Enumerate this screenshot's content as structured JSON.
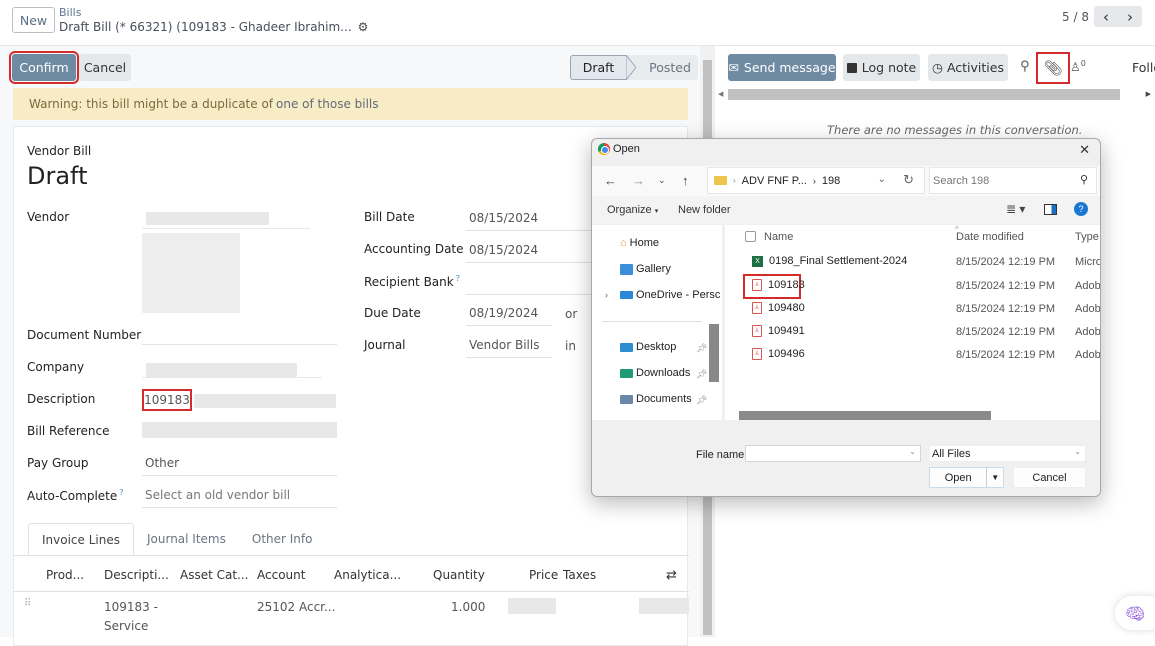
{
  "header": {
    "new_label": "New",
    "breadcrumb_parent": "Bills",
    "breadcrumb_current": "Draft Bill (* 66321) (109183 - Ghadeer Ibrahim...",
    "pager": "5 / 8",
    "prev_icon": "chevron-left",
    "next_icon": "chevron-right"
  },
  "actions": {
    "confirm_label": "Confirm",
    "cancel_label": "Cancel",
    "status_steps": [
      "Draft",
      "Posted"
    ],
    "status_current": "Draft"
  },
  "warning": {
    "text": "Warning: this bill might be a duplicate of",
    "link": "one of those bills"
  },
  "form": {
    "doc_type": "Vendor Bill",
    "title": "Draft",
    "left_labels": {
      "vendor": "Vendor",
      "document_number": "Document Number",
      "company": "Company",
      "description": "Description",
      "bill_reference": "Bill Reference",
      "pay_group": "Pay Group",
      "auto_complete": "Auto-Complete"
    },
    "description_value": "109183",
    "pay_group_value": "Other",
    "auto_complete_placeholder": "Select an old vendor bill",
    "right_labels": {
      "bill_date": "Bill Date",
      "accounting_date": "Accounting Date",
      "recipient_bank": "Recipient Bank",
      "due_date": "Due Date",
      "journal": "Journal"
    },
    "bill_date": "08/15/2024",
    "accounting_date": "08/15/2024",
    "due_date": "08/19/2024",
    "due_suffix": "or",
    "journal": "Vendor Bills",
    "journal_suffix": "in",
    "help_mark": "?"
  },
  "tabs": [
    "Invoice Lines",
    "Journal Items",
    "Other Info"
  ],
  "lines_table": {
    "columns": [
      "Prod...",
      "Descripti...",
      "Asset Cat...",
      "Account",
      "Analytica...",
      "Quantity",
      "Price",
      "Taxes"
    ],
    "rows": [
      {
        "description": [
          "109183 -",
          "Service"
        ],
        "account": "25102 Accr...",
        "quantity": "1.000"
      }
    ]
  },
  "chatter": {
    "send_message": "Send message",
    "log_note": "Log note",
    "activities": "Activities",
    "followers_count": "0",
    "follow_label": "Follo",
    "empty_text": "There are no messages in this conversation."
  },
  "dialog": {
    "title": "Open",
    "path": [
      "ADV FNF P...",
      "198"
    ],
    "search_placeholder": "Search 198",
    "organize": "Organize",
    "new_folder": "New folder",
    "nav_items": [
      {
        "label": "Home",
        "icon": "home"
      },
      {
        "label": "Gallery",
        "icon": "gallery"
      },
      {
        "label": "OneDrive - Persc",
        "icon": "onedrive"
      },
      {
        "label": "Desktop",
        "icon": "desktop",
        "pinned": true
      },
      {
        "label": "Downloads",
        "icon": "downloads",
        "pinned": true
      },
      {
        "label": "Documents",
        "icon": "documents",
        "pinned": true
      }
    ],
    "columns": [
      "Name",
      "Date modified",
      "Type"
    ],
    "files": [
      {
        "name": "0198_Final Settlement-2024",
        "date": "8/15/2024 12:19 PM",
        "type": "Micro",
        "icon": "excel"
      },
      {
        "name": "109183",
        "date": "8/15/2024 12:19 PM",
        "type": "Adobe",
        "icon": "pdf"
      },
      {
        "name": "109480",
        "date": "8/15/2024 12:19 PM",
        "type": "Adobe",
        "icon": "pdf"
      },
      {
        "name": "109491",
        "date": "8/15/2024 12:19 PM",
        "type": "Adobe",
        "icon": "pdf"
      },
      {
        "name": "109496",
        "date": "8/15/2024 12:19 PM",
        "type": "Adobe",
        "icon": "pdf"
      }
    ],
    "file_name_label": "File name:",
    "file_name_value": "",
    "filter_value": "All Files",
    "open_label": "Open",
    "cancel_label": "Cancel"
  }
}
